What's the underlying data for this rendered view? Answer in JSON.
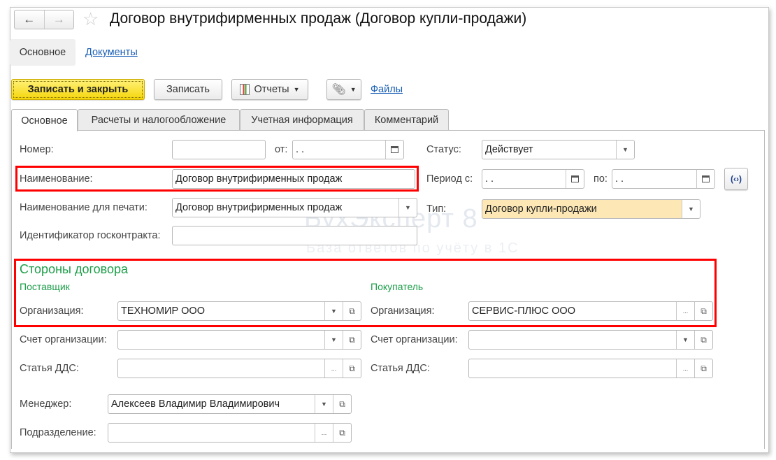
{
  "window": {
    "title": "Договор внутрифирменных продаж (Договор купли-продажи)"
  },
  "nav": {
    "back": "←",
    "forward": "→"
  },
  "panel_tabs": [
    "Основное",
    "Документы"
  ],
  "toolbar": {
    "save_close": "Записать и закрыть",
    "save": "Записать",
    "reports": "Отчеты",
    "files": "Файлы"
  },
  "tabs": [
    "Основное",
    "Расчеты и налогообложение",
    "Учетная информация",
    "Комментарий"
  ],
  "form": {
    "number_label": "Номер:",
    "number": "",
    "from_label": "от:",
    "date": " .  .",
    "status_label": "Статус:",
    "status": "Действует",
    "name_label": "Наименование:",
    "name": "Договор внутрифирменных продаж",
    "period_label": "Период с:",
    "period_from": " .  .",
    "to_label": "по:",
    "period_to": " .  .",
    "print_name_label": "Наименование для печати:",
    "print_name": "Договор внутрифирменных продаж",
    "type_label": "Тип:",
    "type": "Договор купли-продажи",
    "gov_id_label": "Идентификатор госконтракта:",
    "gov_id": ""
  },
  "parties": {
    "title": "Стороны договора",
    "supplier": {
      "title": "Поставщик",
      "org_label": "Организация:",
      "org": "ТЕХНОМИР ООО",
      "account_label": "Счет организации:",
      "account": "",
      "dds_label": "Статья ДДС:",
      "dds": ""
    },
    "buyer": {
      "title": "Покупатель",
      "org_label": "Организация:",
      "org": "СЕРВИС-ПЛЮС ООО",
      "account_label": "Счет организации:",
      "account": "",
      "dds_label": "Статья ДДС:",
      "dds": ""
    }
  },
  "manager": {
    "label": "Менеджер:",
    "value": "Алексеев Владимир Владимирович"
  },
  "department": {
    "label": "Подразделение:",
    "value": ""
  },
  "watermark": {
    "brand": "БухЭксперт 8",
    "tagline": "База ответов по учёту в 1С"
  },
  "colors": {
    "accent_yellow": "#f5d60a",
    "highlight": "#ff0000",
    "group_green": "#1d9e4a"
  }
}
